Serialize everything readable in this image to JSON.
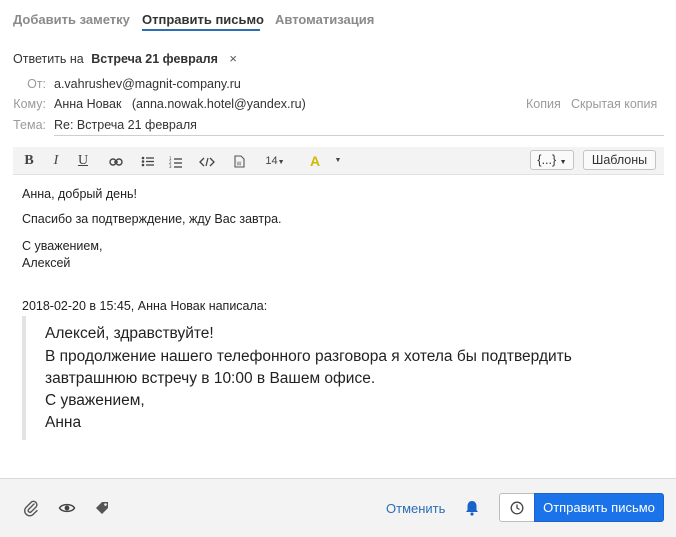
{
  "tabs": [
    {
      "label": "Добавить заметку"
    },
    {
      "label": "Отправить письмо"
    },
    {
      "label": "Автоматизация"
    }
  ],
  "reply": {
    "prefix": "Ответить на",
    "subject": "Встреча 21 февраля",
    "close": "×"
  },
  "fields": {
    "from_label": "От:",
    "from_value": "a.vahrushev@magnit-company.ru",
    "to_label": "Кому:",
    "to_value": "Анна Новак   (anna.nowak.hotel@yandex.ru)",
    "subject_label": "Тема:",
    "subject_value": "Re: Встреча 21 февраля",
    "cc_link": "Копия",
    "bcc_link": "Скрытая копия"
  },
  "toolbar": {
    "bold": "B",
    "italic": "I",
    "underline": "U",
    "font_size": "14",
    "highlight": "A",
    "variables": "{...}",
    "templates": "Шаблоны"
  },
  "message": {
    "greeting": "Анна, добрый день!",
    "line1": "Спасибо за подтверждение, жду Вас завтра.",
    "regards": "С уважением,",
    "signature": "Алексей",
    "quote_header": "2018-02-20 в 15:45, Анна Новак написала:",
    "quote_lines": [
      "Алексей, здравствуйте!",
      "В продолжение нашего телефонного разговора я хотела бы подтвердить",
      "завтрашнюю встречу в 10:00 в Вашем офисе.",
      "С уважением,",
      "Анна"
    ]
  },
  "footer": {
    "cancel": "Отменить",
    "send": "Отправить письмо",
    "icons": [
      "paperclip-icon",
      "eye-icon",
      "tag-icon",
      "bell-icon",
      "clock-icon"
    ]
  },
  "colors": {
    "accent": "#1a73e8",
    "link": "#2a6fb5",
    "highlight": "#d4b800"
  }
}
